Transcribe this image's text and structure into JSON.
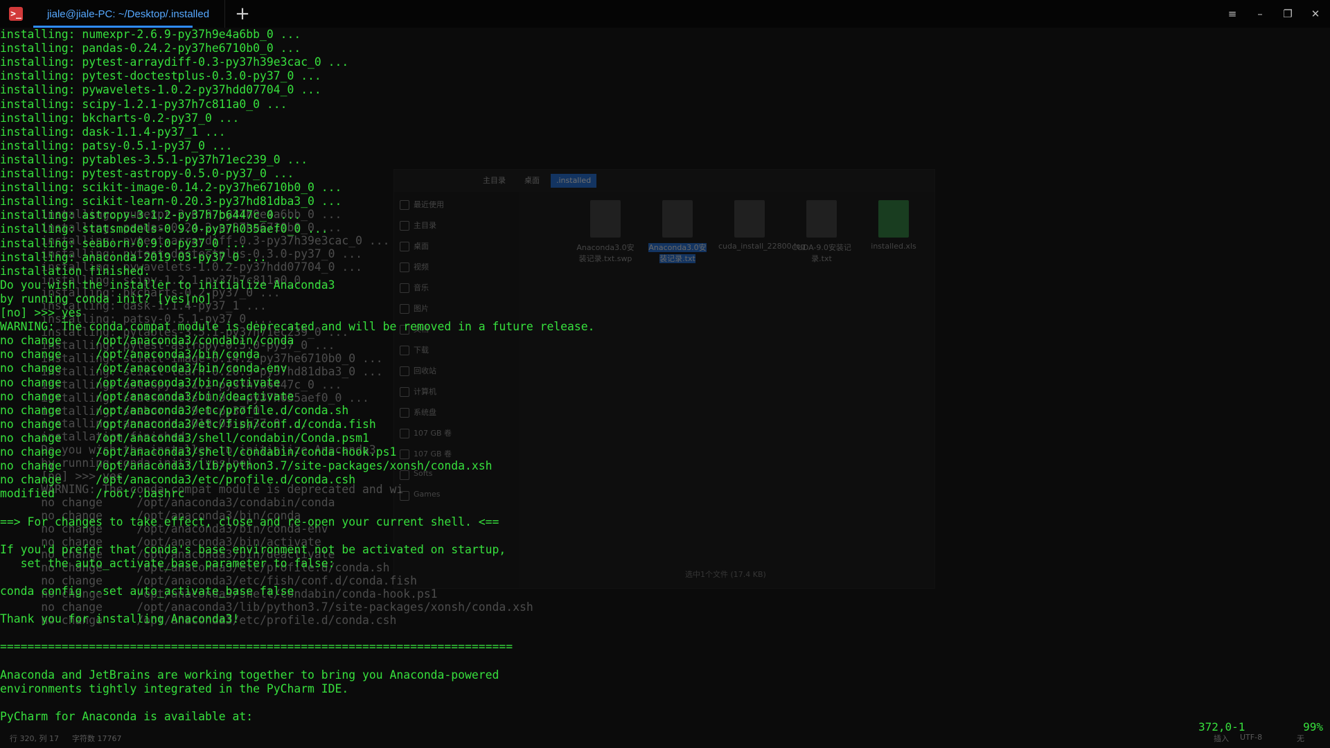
{
  "titlebar": {
    "app_icon": "terminal-icon",
    "tab_title": "jiale@jiale-PC: ~/Desktop/.installed",
    "new_tab": "+",
    "menu": "≡",
    "minimize": "–",
    "maximize": "❐",
    "close": "✕"
  },
  "terminal": {
    "lines": [
      "installing: numexpr-2.6.9-py37h9e4a6bb_0 ...",
      "installing: pandas-0.24.2-py37he6710b0_0 ...",
      "installing: pytest-arraydiff-0.3-py37h39e3cac_0 ...",
      "installing: pytest-doctestplus-0.3.0-py37_0 ...",
      "installing: pywavelets-1.0.2-py37hdd07704_0 ...",
      "installing: scipy-1.2.1-py37h7c811a0_0 ...",
      "installing: bkcharts-0.2-py37_0 ...",
      "installing: dask-1.1.4-py37_1 ...",
      "installing: patsy-0.5.1-py37_0 ...",
      "installing: pytables-3.5.1-py37h71ec239_0 ...",
      "installing: pytest-astropy-0.5.0-py37_0 ...",
      "installing: scikit-image-0.14.2-py37he6710b0_0 ...",
      "installing: scikit-learn-0.20.3-py37hd81dba3_0 ...",
      "installing: astropy-3.1.2-py37h7b6447c_0 ...",
      "installing: statsmodels-0.9.0-py37h035aef0_0 ...",
      "installing: seaborn-0.9.0-py37_0 ...",
      "installing: anaconda-2019.03-py37_0 ...",
      "installation finished.",
      "Do you wish the installer to initialize Anaconda3",
      "by running conda init? [yes|no]",
      "[no] >>> yes",
      "WARNING: The conda.compat module is deprecated and will be removed in a future release.",
      "no change     /opt/anaconda3/condabin/conda",
      "no change     /opt/anaconda3/bin/conda",
      "no change     /opt/anaconda3/bin/conda-env",
      "no change     /opt/anaconda3/bin/activate",
      "no change     /opt/anaconda3/bin/deactivate",
      "no change     /opt/anaconda3/etc/profile.d/conda.sh",
      "no change     /opt/anaconda3/etc/fish/conf.d/conda.fish",
      "no change     /opt/anaconda3/shell/condabin/Conda.psm1",
      "no change     /opt/anaconda3/shell/condabin/conda-hook.ps1",
      "no change     /opt/anaconda3/lib/python3.7/site-packages/xonsh/conda.xsh",
      "no change     /opt/anaconda3/etc/profile.d/conda.csh",
      "modified      /root/.bashrc",
      "",
      "==> For changes to take effect, close and re-open your current shell. <==",
      "",
      "If you'd prefer that conda's base environment not be activated on startup,",
      "   set the auto_activate_base parameter to false:",
      "",
      "conda config --set auto_activate_base false",
      "",
      "Thank you for installing Anaconda3!",
      "",
      "===========================================================================",
      "",
      "Anaconda and JetBrains are working together to bring you Anaconda-powered",
      "environments tightly integrated in the PyCharm IDE.",
      "",
      "PyCharm for Anaconda is available at:"
    ]
  },
  "ghost": {
    "lines": [
      {
        "num": "",
        "text": "      installing: numexpr-2.6.9-py37h9e4a6bb_0 ..."
      },
      {
        "num": "",
        "text": "      installing: pandas-0.24.2-py37he6710b0_0 ..."
      },
      {
        "num": "",
        "text": "      installing: pytest-arraydiff-0.3-py37h39e3cac_0 ..."
      },
      {
        "num": "",
        "text": "      installing: pytest-doctestplus-0.3.0-py37_0 ..."
      },
      {
        "num": "",
        "text": "      installing: pywavelets-1.0.2-py37hdd07704_0 ..."
      },
      {
        "num": "",
        "text": "      installing: scipy-1.2.1-py37h7c811a0_0 ..."
      },
      {
        "num": "",
        "text": "      installing: bkcharts-0.2-py37_0 ..."
      },
      {
        "num": "",
        "text": "      installing: dask-1.1.4-py37_1 ..."
      },
      {
        "num": "",
        "text": "      installing: patsy-0.5.1-py37_0 ..."
      },
      {
        "num": "",
        "text": "      installing: pytables-3.5.1-py37h71ec239_0 ..."
      },
      {
        "num": "",
        "text": "      installing: pytest-astropy-0.5.0-py37_0 ..."
      },
      {
        "num": "",
        "text": "      installing: scikit-image-0.14.2-py37he6710b0_0 ..."
      },
      {
        "num": "",
        "text": "      installing: scikit-learn-0.20.3-py37hd81dba3_0 ..."
      },
      {
        "num": "",
        "text": "      installing: astropy-3.1.2-py37h7b6447c_0 ..."
      },
      {
        "num": "",
        "text": "      installing: statsmodels-0.9.0-py37h035aef0_0 ..."
      },
      {
        "num": "",
        "text": "      installing: seaborn-0.9.0-py37_0 ..."
      },
      {
        "num": "",
        "text": "      installing: anaconda-2019.03-py37_0 ..."
      },
      {
        "num": "",
        "text": "      installation finished."
      },
      {
        "num": "",
        "text": "      Do you wish the installer to initialize Anaconda3"
      },
      {
        "num": "",
        "text": "      by running conda init? [yes|no]"
      },
      {
        "num": "",
        "text": "      [no] >>> yes"
      },
      {
        "num": "",
        "text": "      WARNING: The conda.compat module is deprecated and wi"
      },
      {
        "num": "",
        "text": "      no change     /opt/anaconda3/condabin/conda"
      },
      {
        "num": "",
        "text": "      no change     /opt/anaconda3/bin/conda"
      },
      {
        "num": "",
        "text": "      no change     /opt/anaconda3/bin/conda-env"
      },
      {
        "num": "",
        "text": "      no change     /opt/anaconda3/bin/activate"
      },
      {
        "num": "",
        "text": "      no change     /opt/anaconda3/bin/deactivate"
      },
      {
        "num": "",
        "text": "      no change     /opt/anaconda3/etc/profile.d/conda.sh"
      },
      {
        "num": "",
        "text": "      no change     /opt/anaconda3/etc/fish/conf.d/conda.fish"
      },
      {
        "num": "",
        "text": "      no change     /opt/anaconda3/shell/condabin/conda-hook.ps1"
      },
      {
        "num": "",
        "text": "      no change     /opt/anaconda3/lib/python3.7/site-packages/xonsh/conda.xsh"
      },
      {
        "num": "",
        "text": "      no change     /opt/anaconda3/etc/profile.d/conda.csh"
      }
    ]
  },
  "file_manager": {
    "crumbs": [
      "主目录",
      "桌面",
      ".installed"
    ],
    "sidebar": [
      "最近使用",
      "主目录",
      "桌面",
      "视频",
      "音乐",
      "图片",
      "文档",
      "下载",
      "回收站",
      "计算机",
      "系统盘",
      "107 GB 卷",
      "107 GB 卷",
      "Softs",
      "Games"
    ],
    "files": [
      {
        "name": "Anaconda3.0安装记录.txt.swp",
        "type": "generic"
      },
      {
        "name": "Anaconda3.0安装记录.txt",
        "type": "doc",
        "selected": true
      },
      {
        "name": "cuda_install_22800.log",
        "type": "generic"
      },
      {
        "name": "CUDA-9.0安装记录.txt",
        "type": "doc"
      },
      {
        "name": "installed.xls",
        "type": "xls"
      }
    ],
    "status": "选中1个文件 (17.4 KB)"
  },
  "status": {
    "cursor": "372,0-1",
    "percent": "99%",
    "left_info": "行 320, 列 17",
    "chars": "字符数 17767",
    "mode": "插入",
    "encoding": "UTF-8",
    "wrap": "无"
  },
  "colors": {
    "terminal_text": "#37e03d",
    "tab_accent": "#2f8cff"
  }
}
